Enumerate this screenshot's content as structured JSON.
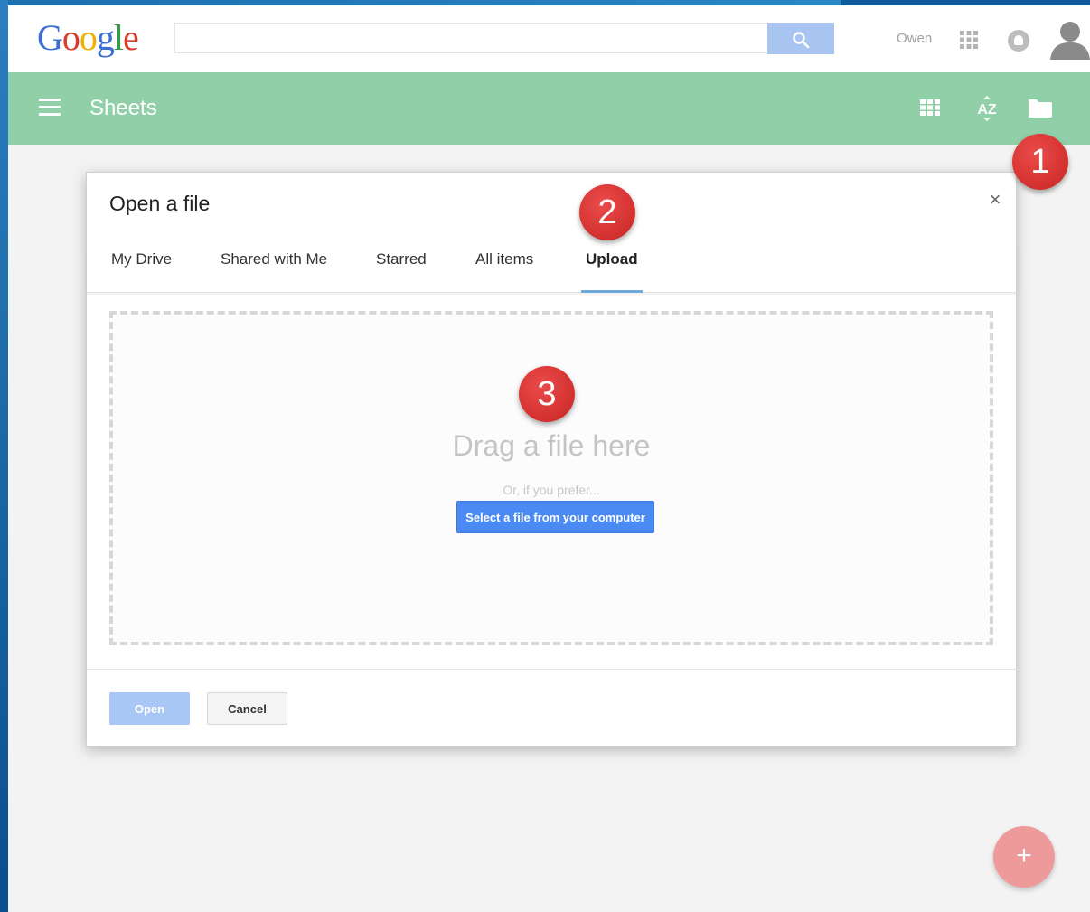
{
  "header": {
    "logo_letters": [
      "G",
      "o",
      "o",
      "g",
      "l",
      "e"
    ],
    "logo_colors": [
      "#3d6fd3",
      "#d93c2b",
      "#f0b000",
      "#3d6fd3",
      "#2f9e45",
      "#d93c2b"
    ],
    "search_placeholder": "",
    "user_name": "Owen"
  },
  "app_bar": {
    "title": "Sheets",
    "color": "#91cfa9"
  },
  "markers": [
    "1",
    "2",
    "3"
  ],
  "dialog": {
    "title": "Open a file",
    "close_label": "×",
    "tabs": [
      {
        "label": "My Drive"
      },
      {
        "label": "Shared with Me"
      },
      {
        "label": "Starred"
      },
      {
        "label": "All items"
      },
      {
        "label": "Upload",
        "active": true
      }
    ],
    "drop_heading": "Drag a file here",
    "drop_sub": "Or, if you prefer...",
    "select_label": "Select a file from your computer",
    "open_label": "Open",
    "cancel_label": "Cancel"
  },
  "fab_label": "+",
  "icons": [
    "search-icon",
    "apps-grid-icon",
    "notification-icon",
    "avatar-icon",
    "menu-icon",
    "grid-view-icon",
    "sort-az-icon",
    "folder-icon",
    "close-icon",
    "plus-icon"
  ]
}
